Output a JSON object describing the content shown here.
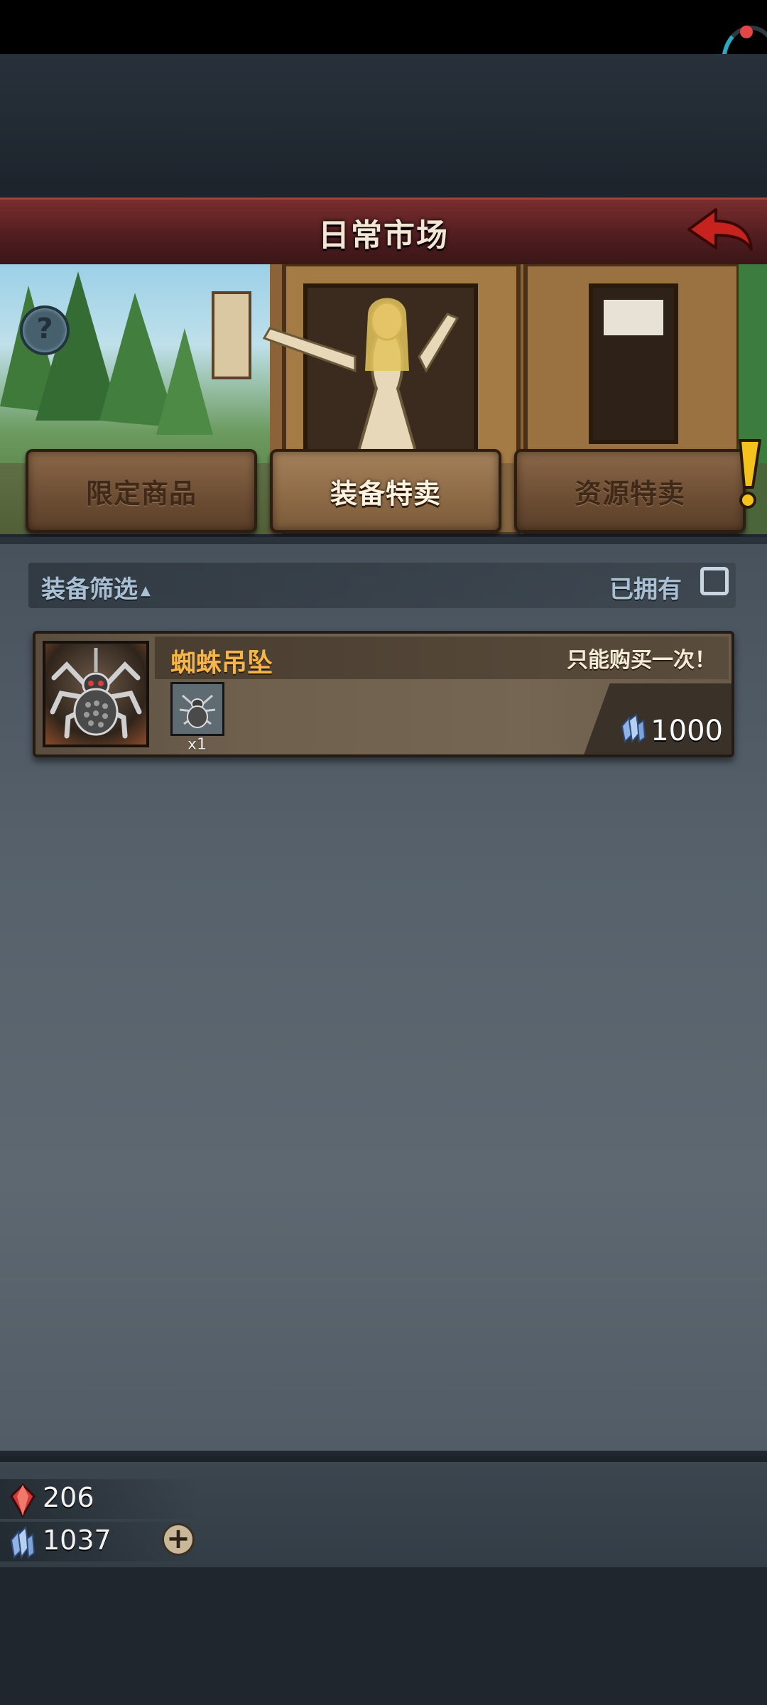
{
  "header": {
    "title": "日常市场"
  },
  "tabs": [
    {
      "label": "限定商品",
      "active": false
    },
    {
      "label": "装备特卖",
      "active": true
    },
    {
      "label": "资源特卖",
      "active": false,
      "alert": true
    }
  ],
  "filter": {
    "label": "装备筛选",
    "owned_label": "已拥有",
    "owned_checked": false
  },
  "items": [
    {
      "name": "蜘蛛吊坠",
      "limit": "只能购买一次！",
      "reward_qty": "x1",
      "price": "1000",
      "currency": "crystal-icon"
    }
  ],
  "currencies": [
    {
      "name": "red-gem-icon",
      "value": "206"
    },
    {
      "name": "crystal-icon",
      "value": "1037"
    }
  ],
  "colors": {
    "title_bar": "#5b2022",
    "item_name": "#f6b548",
    "panel": "#56616b"
  }
}
